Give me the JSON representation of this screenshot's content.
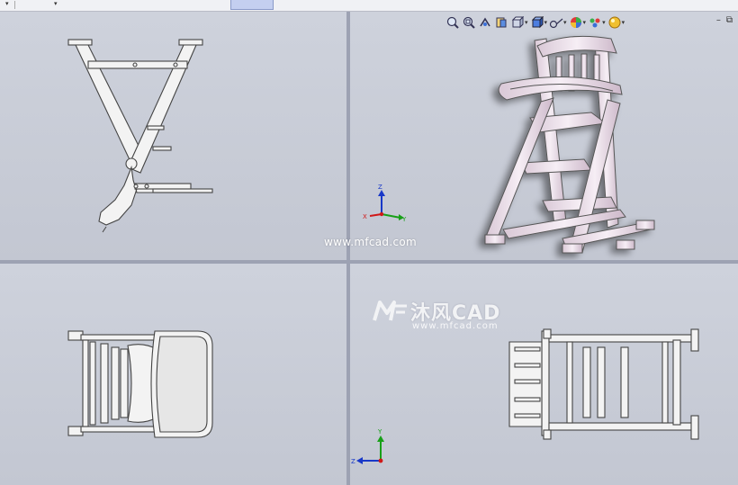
{
  "watermark": {
    "url": "www.mfcad.com",
    "logo_text": "沐风CAD",
    "logo_url": "www.mfcad.com"
  },
  "axes": {
    "x": "X",
    "y": "Y",
    "z": "Z"
  },
  "window_controls": {
    "minimize": "–",
    "restore": "⧉"
  },
  "view_toolbar": [
    "zoom-to-fit-icon",
    "zoom-to-area-icon",
    "previous-view-icon",
    "section-view-icon",
    "view-orientation-icon",
    "display-style-icon",
    "hide-show-items-icon",
    "edit-appearance-icon",
    "apply-scene-icon",
    "view-settings-icon"
  ],
  "colors": {
    "viewport_bg": "#c9cdd8",
    "splitter": "#9da2b3",
    "part_fill": "#f3f3f3",
    "part_edge": "#444444",
    "iso_part_fill": "#f1e6ef",
    "axis_x": "#d01818",
    "axis_y": "#18a018",
    "axis_z": "#1838c8"
  }
}
